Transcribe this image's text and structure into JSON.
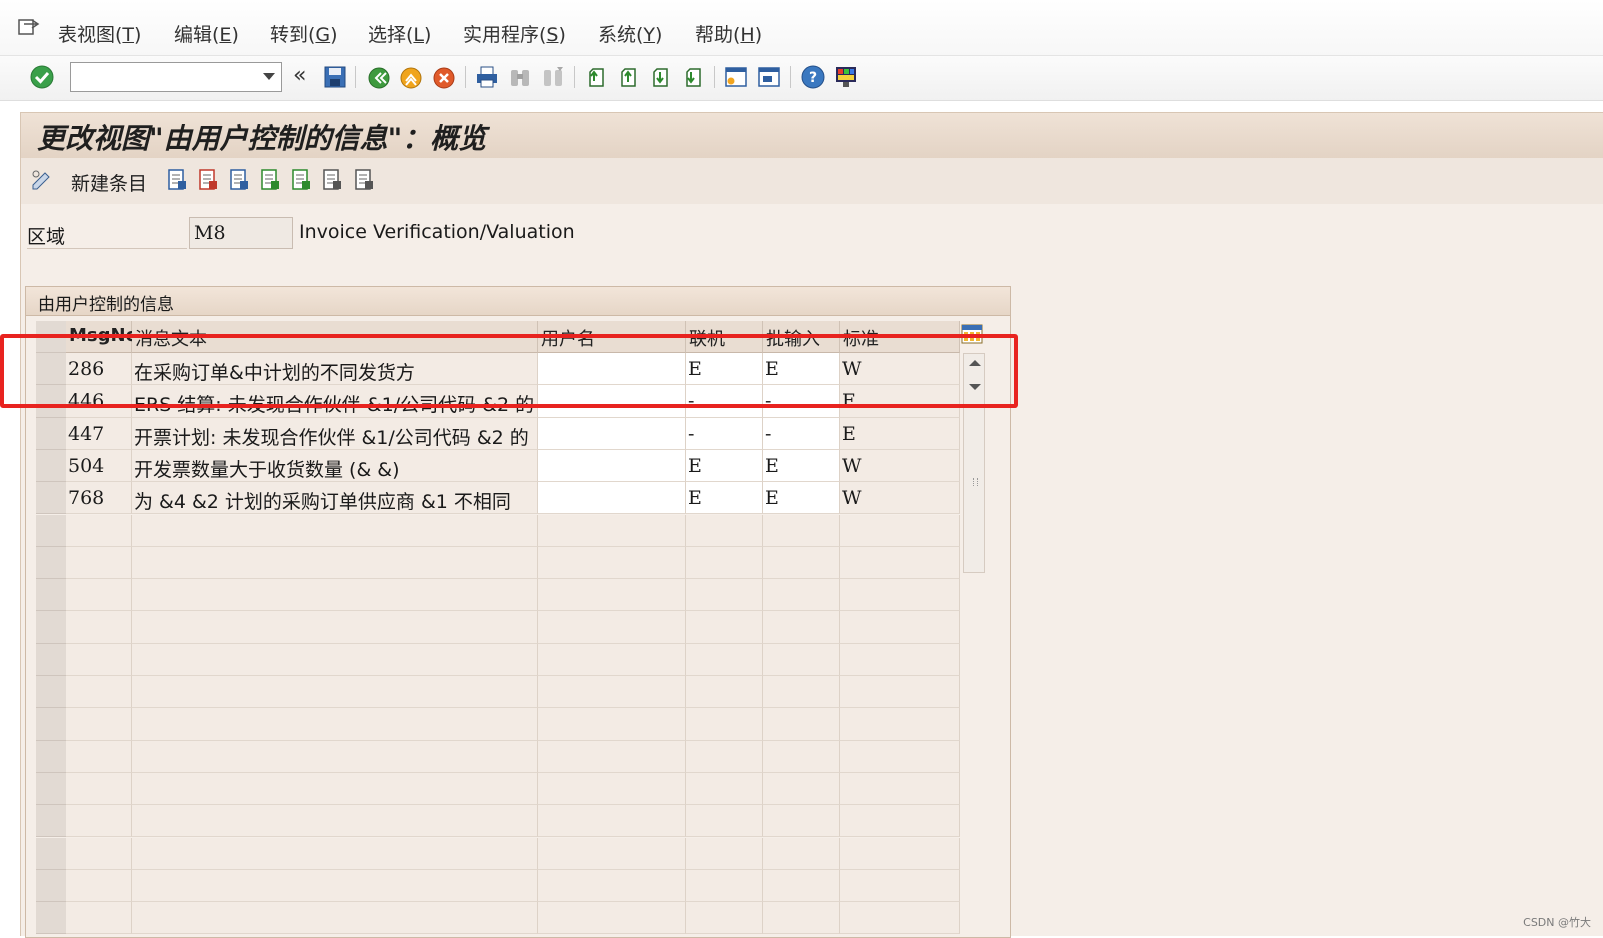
{
  "menubar": {
    "items": [
      {
        "label": "表视图(",
        "key": "T",
        "tail": ")"
      },
      {
        "label": "编辑(",
        "key": "E",
        "tail": ")"
      },
      {
        "label": "转到(",
        "key": "G",
        "tail": ")"
      },
      {
        "label": "选择(",
        "key": "L",
        "tail": ")"
      },
      {
        "label": "实用程序(",
        "key": "S",
        "tail": ")"
      },
      {
        "label": "系统(",
        "key": "Y",
        "tail": ")"
      },
      {
        "label": "帮助(",
        "key": "H",
        "tail": ")"
      }
    ]
  },
  "toolbar": {
    "command_value": "",
    "back_chevron": "«",
    "icons": [
      "enter-check-icon",
      "save-icon",
      "back-icon",
      "exit-icon",
      "cancel-icon",
      "print-icon",
      "find-icon",
      "find-next-icon",
      "first-page-icon",
      "previous-page-icon",
      "next-page-icon",
      "last-page-icon",
      "create-session-icon",
      "shortcut-icon",
      "help-icon",
      "layout-menu-icon"
    ]
  },
  "title": "更改视图\"由用户控制的信息\"：概览",
  "app_toolbar": {
    "new_entries": "新建条目",
    "icons": [
      "display-change-icon",
      "copy-as-icon",
      "delete-icon",
      "undo-change-icon",
      "select-all-icon",
      "select-block-icon",
      "deselect-all-icon",
      "configuration-icon"
    ]
  },
  "area": {
    "label": "区域",
    "value": "M8",
    "description": "Invoice Verification/Valuation"
  },
  "table": {
    "group_title": "由用户控制的信息",
    "columns": [
      "MsgNo",
      "消息文本",
      "用户名",
      "联机",
      "批输入",
      "标准"
    ],
    "rows": [
      {
        "msgno": "286",
        "text": "在采购订单&中计划的不同发货方",
        "user": "",
        "online": "E",
        "batch": "E",
        "standard": "W"
      },
      {
        "msgno": "446",
        "text": "ERS 结算: 未发现合作伙伴 &1/公司代码 &2 的",
        "user": "",
        "online": "-",
        "batch": "-",
        "standard": "E"
      },
      {
        "msgno": "447",
        "text": "开票计划: 未发现合作伙伴 &1/公司代码 &2 的",
        "user": "",
        "online": "-",
        "batch": "-",
        "standard": "E"
      },
      {
        "msgno": "504",
        "text": "开发票数量大于收货数量 (& &)",
        "user": "",
        "online": "E",
        "batch": "E",
        "standard": "W"
      },
      {
        "msgno": "768",
        "text": "为 &4 &2 计划的采购订单供应商 &1 不相同",
        "user": "",
        "online": "E",
        "batch": "E",
        "standard": "W"
      }
    ],
    "empty_rows": 13
  },
  "watermark": "CSDN @竹大",
  "colors": {
    "highlight": "#e8231f",
    "title_bg": "#e3d3c4",
    "table_bg": "#f3ebe4"
  }
}
